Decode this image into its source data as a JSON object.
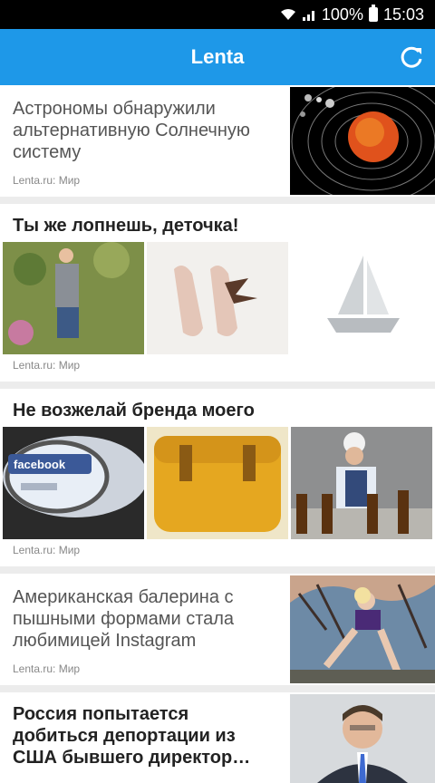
{
  "status": {
    "battery": "100%",
    "time": "15:03"
  },
  "appbar": {
    "title": "Lenta",
    "refresh_icon": "refresh-icon"
  },
  "feed": [
    {
      "headline": "Астрономы обнаружили альтернативную Солнечную систему",
      "source": "Lenta.ru: Мир"
    },
    {
      "headline": "Ты же лопнешь, деточка!",
      "source": "Lenta.ru: Мир"
    },
    {
      "headline": "Не возжелай бренда моего",
      "source": "Lenta.ru: Мир"
    },
    {
      "headline": "Американская балерина с пышными формами стала любимицей Instagram",
      "source": "Lenta.ru: Мир"
    },
    {
      "headline": "Россия попытается добиться депортации из США бывшего директор…"
    }
  ],
  "image_texts": {
    "facebook": "facebook"
  }
}
